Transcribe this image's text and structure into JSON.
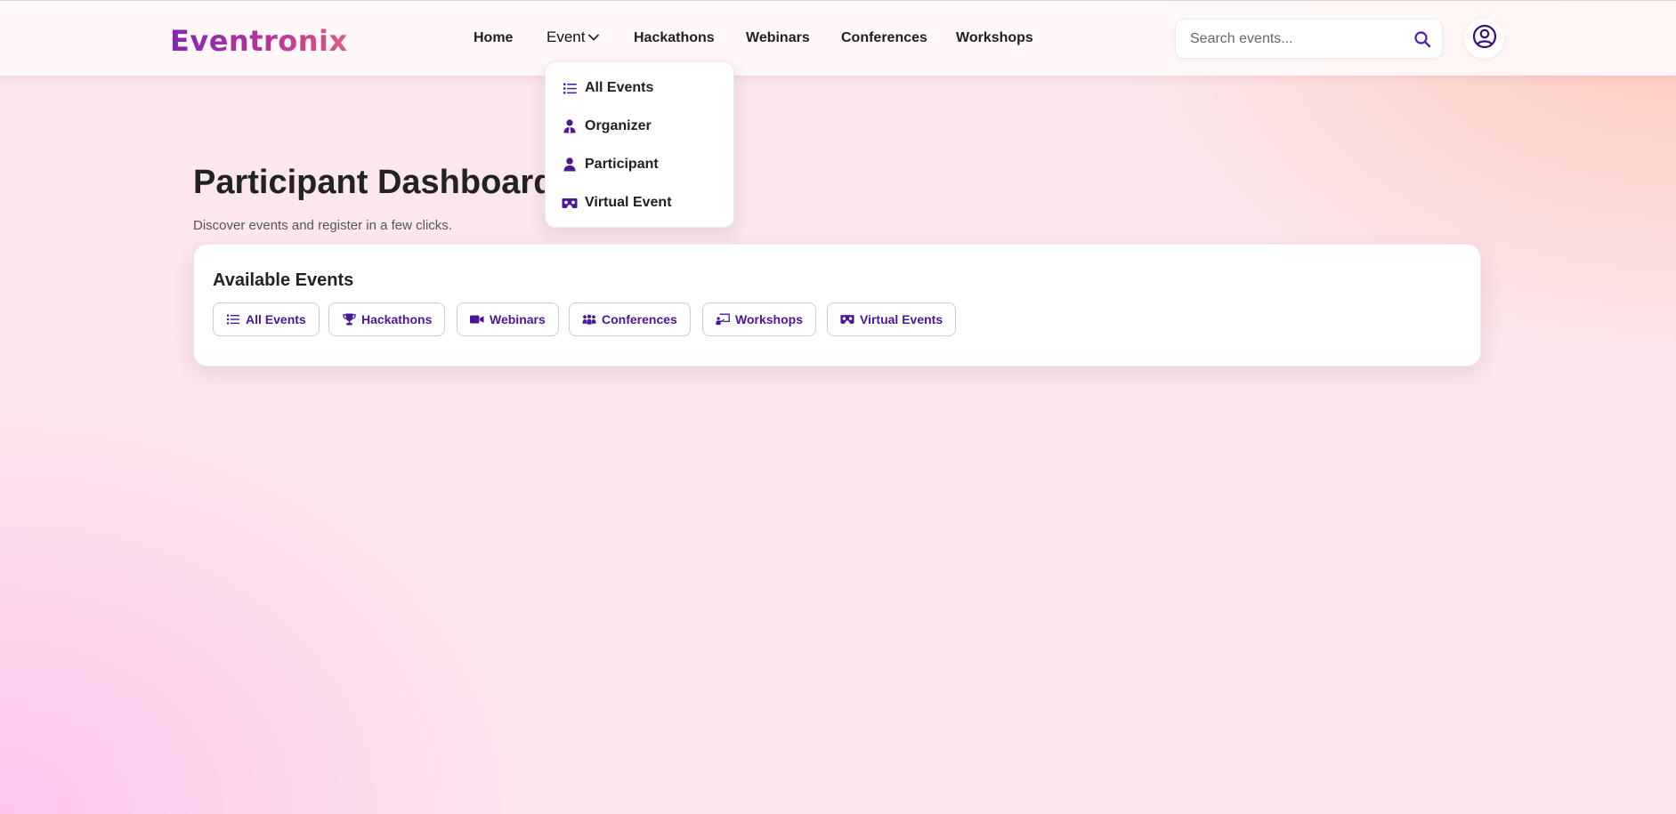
{
  "brand": {
    "name": "Eventronix"
  },
  "colors": {
    "accent": "#4b1796",
    "brand_start": "#8227b2",
    "brand_end": "#e05a85"
  },
  "nav": {
    "items": [
      {
        "label": "Home"
      },
      {
        "label": "Event",
        "has_dropdown": true,
        "open": true
      },
      {
        "label": "Hackathons"
      },
      {
        "label": "Webinars"
      },
      {
        "label": "Conferences"
      },
      {
        "label": "Workshops"
      }
    ]
  },
  "search": {
    "placeholder": "Search events...",
    "value": ""
  },
  "user": {
    "icon": "user-circle-icon"
  },
  "event_dropdown": {
    "items": [
      {
        "label": "All Events",
        "icon": "list-icon"
      },
      {
        "label": "Organizer",
        "icon": "user-tie-icon"
      },
      {
        "label": "Participant",
        "icon": "user-icon"
      },
      {
        "label": "Virtual Event",
        "icon": "vr-headset-icon"
      }
    ]
  },
  "page": {
    "title": "Participant Dashboard",
    "subtitle": "Discover events and register in a few clicks."
  },
  "available_events": {
    "title": "Available Events",
    "filters": [
      {
        "label": "All Events",
        "icon": "list-icon"
      },
      {
        "label": "Hackathons",
        "icon": "trophy-icon"
      },
      {
        "label": "Webinars",
        "icon": "video-camera-icon"
      },
      {
        "label": "Conferences",
        "icon": "people-group-icon"
      },
      {
        "label": "Workshops",
        "icon": "chalkboard-user-icon"
      },
      {
        "label": "Virtual Events",
        "icon": "vr-headset-icon"
      }
    ]
  }
}
